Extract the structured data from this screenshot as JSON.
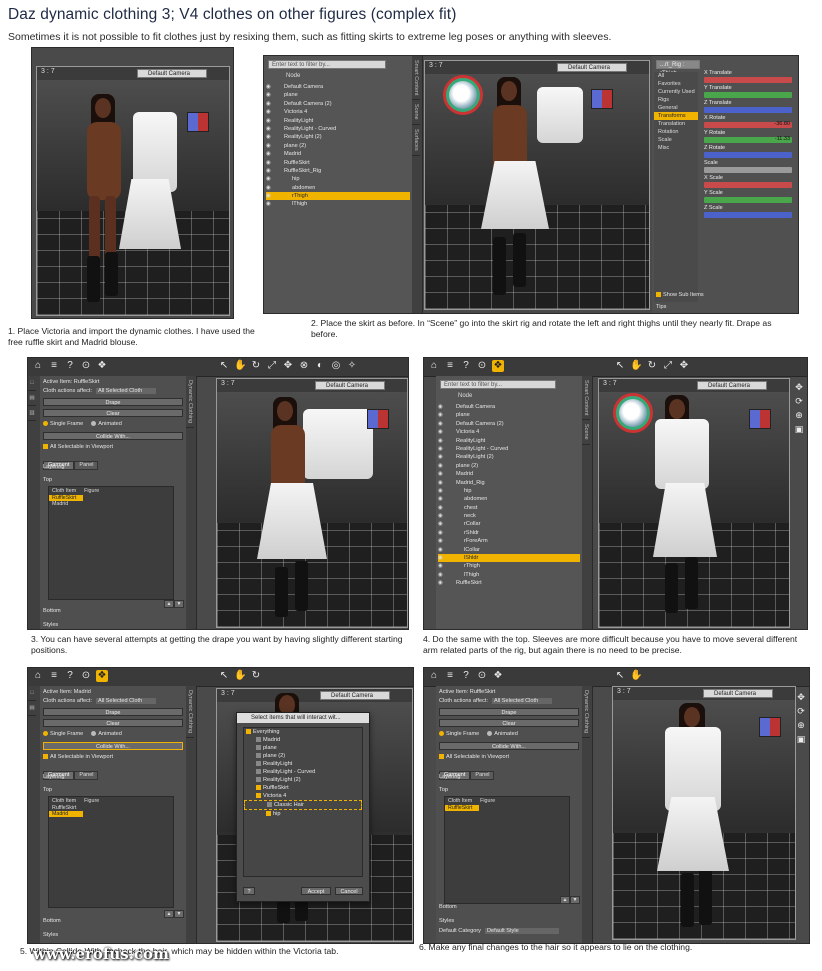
{
  "header": {
    "title": "Daz dynamic clothing 3; V4 clothes on other figures (complex fit)",
    "subtitle": "Sometimes it is not possible to fit clothes just by resixing them, such as fitting skirts to extreme leg poses or anything with sleeves."
  },
  "common": {
    "viewport_index": "3 : 7",
    "camera": "Default Camera",
    "filter_placeholder": "Enter text to filter by...",
    "node_header": "Node"
  },
  "steps": [
    {
      "caption": "1. Place Victoria and import the dynamic clothes. I have used the free ruffle skirt and Madrid blouse."
    },
    {
      "caption": "2. Place the skirt as before. In “Scene” go into the skirt rig and rotate the left and right thighs until they nearly fit. Drape as before."
    },
    {
      "caption": "3. You can have several attempts at getting the drape you want by having slightly different starting positions."
    },
    {
      "caption": "4. Do the same with the top. Sleeves are more difficult because you have to move several different arm related parts of the rig, but again there is no need to be precise."
    },
    {
      "caption": "5. Within Collide With uncheck the hair, which may be hidden within the Victoria tab."
    },
    {
      "caption": "6. Make any final changes to the hair so it appears to lie on the clothing."
    }
  ],
  "scene2": {
    "nodes": [
      "Default Camera",
      "plane",
      "Default Camera (2)",
      "Victoria 4",
      "RealityLight",
      "RealityLight - Curved",
      "RealityLight (2)",
      "plane (2)",
      "Madrid",
      "RuffleSkirt",
      "RuffleSkirt_Rig",
      "hip",
      "abdomen",
      "rThigh",
      "lThigh"
    ],
    "selected": "rThigh",
    "rig_select": "...rt_Rig : rThigh",
    "param_groups": [
      "All",
      "Favorites",
      "Currently Used",
      "Rigs",
      "General",
      "Transforms",
      "Translation",
      "Rotation",
      "Scale",
      "Misc"
    ],
    "show_sub_items": "Show Sub Items",
    "tips": "Tips",
    "sliders": [
      {
        "label": "X Translate",
        "value": "",
        "color": "#c94a4a"
      },
      {
        "label": "Y Translate",
        "value": "",
        "color": "#4aa64a"
      },
      {
        "label": "Z Translate",
        "value": "",
        "color": "#4a62c9"
      },
      {
        "label": "X Rotate",
        "value": "-36.80",
        "color": "#c94a4a"
      },
      {
        "label": "Y Rotate",
        "value": "-11.33",
        "color": "#4aa64a"
      },
      {
        "label": "Z Rotate",
        "value": "",
        "color": "#4a62c9"
      },
      {
        "label": "Scale",
        "value": "",
        "color": "#9a9a9a"
      },
      {
        "label": "X Scale",
        "value": "",
        "color": "#c94a4a"
      },
      {
        "label": "Y Scale",
        "value": "",
        "color": "#4aa64a"
      },
      {
        "label": "Z Scale",
        "value": "",
        "color": "#4a62c9"
      }
    ]
  },
  "scene4": {
    "nodes": [
      "Default Camera",
      "plane",
      "Default Camera (2)",
      "Victoria 4",
      "RealityLight",
      "RealityLight - Curved",
      "RealityLight (2)",
      "plane (2)",
      "Madrid",
      "Madrid_Rig",
      "hip",
      "abdomen",
      "chest",
      "neck",
      "rCollar",
      "rShldr",
      "rForeArm",
      "lCollar",
      "lShldr",
      "rThigh",
      "lThigh",
      "RuffleSkirt"
    ],
    "selected": "lShldr"
  },
  "dyn3": {
    "active_item": "Active Item: RuffleSkirt",
    "cloth_affect_label": "Cloth actions affect:",
    "cloth_affect_value": "All Selected Cloth",
    "drape": "Drape",
    "clear": "Clear",
    "single_frame": "Single Frame",
    "animated": "Animated",
    "collide_with": "Collide With...",
    "all_selectable": "All Selectable in Viewport",
    "tab_garment": "Garment",
    "tab_panel": "Panel",
    "layering": "Layering",
    "top": "Top",
    "col_cloth": "Cloth Item",
    "col_figure": "Figure",
    "items": [
      "RuffleSkirt",
      "Madrid"
    ],
    "selected": "RuffleSkirt",
    "bottom": "Bottom",
    "styles": "Styles",
    "side_tab": "Dynamic Clothing"
  },
  "dyn5": {
    "active_item": "Active Item: Madrid",
    "items": [
      "RuffleSkirt",
      "Madrid"
    ],
    "selected": "Madrid"
  },
  "dyn6": {
    "active_item": "Active Item: RuffleSkirt",
    "items": [
      "RuffleSkirt"
    ],
    "selected": "RuffleSkirt",
    "default_category": "Default Category",
    "default_style": "Default Style"
  },
  "dialog5": {
    "title": "Select items that will interact wit...",
    "items": [
      "Everything",
      "Madrid",
      "plane",
      "plane (2)",
      "RealityLight",
      "RealityLight - Curved",
      "RealityLight (2)",
      "RuffleSkirt",
      "Victoria 4",
      "Classic Hair",
      "hip"
    ],
    "highlighted": "Classic Hair",
    "accept": "Accept",
    "cancel": "Cancel",
    "help": "?"
  },
  "watermark": "www.erofus.com",
  "colors": {
    "accent": "#f0b400",
    "panel": "#4a4a4a",
    "viewport": "#2e2e2e"
  }
}
